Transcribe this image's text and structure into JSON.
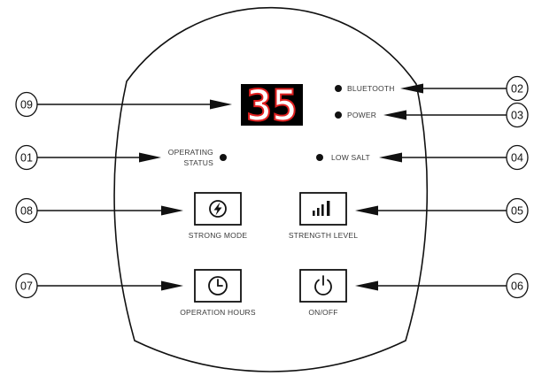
{
  "display": {
    "value": "35"
  },
  "indicators": {
    "bluetooth": "BLUETOOTH",
    "power": "POWER",
    "operating_status": {
      "line1": "OPERATING",
      "line2": "STATUS"
    },
    "low_salt": "LOW SALT"
  },
  "buttons": {
    "strong_mode": {
      "label": "STRONG MODE",
      "icon": "lightning-icon"
    },
    "strength_level": {
      "label": "STRENGTH LEVEL",
      "icon": "signal-bars-icon"
    },
    "operation_hours": {
      "label": "OPERATION HOURS",
      "icon": "clock-icon"
    },
    "on_off": {
      "label": "ON/OFF",
      "icon": "power-icon"
    }
  },
  "callouts": {
    "operating_status": "01",
    "bluetooth": "02",
    "power": "03",
    "low_salt": "04",
    "strength_level": "05",
    "on_off": "06",
    "operation_hours": "07",
    "strong_mode": "08",
    "display": "09"
  },
  "colors": {
    "outline": "#111111",
    "display_background": "#000000",
    "display_digits": "#e02020"
  }
}
